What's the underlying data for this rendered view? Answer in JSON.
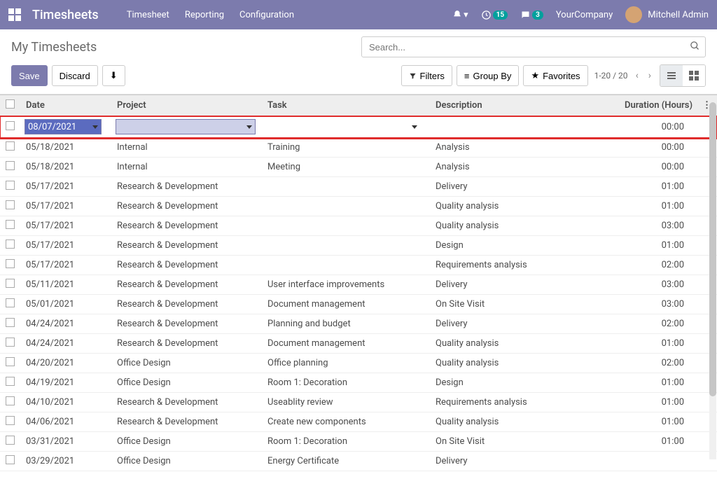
{
  "nav": {
    "brand": "Timesheets",
    "items": [
      "Timesheet",
      "Reporting",
      "Configuration"
    ],
    "activity_badge": "15",
    "chat_badge": "3",
    "company": "YourCompany",
    "user": "Mitchell Admin"
  },
  "header": {
    "title": "My Timesheets",
    "search_placeholder": "Search...",
    "save": "Save",
    "discard": "Discard",
    "filters": "Filters",
    "groupby": "Group By",
    "favorites": "Favorites",
    "pager": "1-20 / 20"
  },
  "columns": {
    "date": "Date",
    "project": "Project",
    "task": "Task",
    "description": "Description",
    "duration": "Duration (Hours)"
  },
  "edit_row": {
    "date": "08/07/2021",
    "duration": "00:00"
  },
  "rows": [
    {
      "date": "05/18/2021",
      "project": "Internal",
      "task": "Training",
      "description": "Analysis",
      "duration": "00:00"
    },
    {
      "date": "05/18/2021",
      "project": "Internal",
      "task": "Meeting",
      "description": "Analysis",
      "duration": "00:00"
    },
    {
      "date": "05/17/2021",
      "project": "Research & Development",
      "task": "",
      "description": "Delivery",
      "duration": "01:00"
    },
    {
      "date": "05/17/2021",
      "project": "Research & Development",
      "task": "",
      "description": "Quality analysis",
      "duration": "01:00"
    },
    {
      "date": "05/17/2021",
      "project": "Research & Development",
      "task": "",
      "description": "Quality analysis",
      "duration": "03:00"
    },
    {
      "date": "05/17/2021",
      "project": "Research & Development",
      "task": "",
      "description": "Design",
      "duration": "01:00"
    },
    {
      "date": "05/17/2021",
      "project": "Research & Development",
      "task": "",
      "description": "Requirements analysis",
      "duration": "02:00"
    },
    {
      "date": "05/11/2021",
      "project": "Research & Development",
      "task": "User interface improvements",
      "description": "Delivery",
      "duration": "03:00"
    },
    {
      "date": "05/01/2021",
      "project": "Research & Development",
      "task": "Document management",
      "description": "On Site Visit",
      "duration": "03:00"
    },
    {
      "date": "04/24/2021",
      "project": "Research & Development",
      "task": "Planning and budget",
      "description": "Delivery",
      "duration": "02:00"
    },
    {
      "date": "04/24/2021",
      "project": "Research & Development",
      "task": "Document management",
      "description": "Quality analysis",
      "duration": "01:00"
    },
    {
      "date": "04/20/2021",
      "project": "Office Design",
      "task": "Office planning",
      "description": "Quality analysis",
      "duration": "02:00"
    },
    {
      "date": "04/19/2021",
      "project": "Office Design",
      "task": "Room 1: Decoration",
      "description": "Design",
      "duration": "01:00"
    },
    {
      "date": "04/10/2021",
      "project": "Research & Development",
      "task": "Useablity review",
      "description": "Requirements analysis",
      "duration": "01:00"
    },
    {
      "date": "04/06/2021",
      "project": "Research & Development",
      "task": "Create new components",
      "description": "Quality analysis",
      "duration": "01:00"
    },
    {
      "date": "03/31/2021",
      "project": "Office Design",
      "task": "Room 1: Decoration",
      "description": "On Site Visit",
      "duration": "01:00"
    },
    {
      "date": "03/29/2021",
      "project": "Office Design",
      "task": "Energy Certificate",
      "description": "Delivery",
      "duration": ""
    }
  ]
}
